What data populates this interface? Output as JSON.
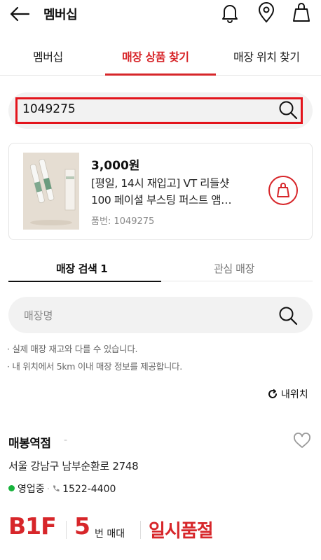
{
  "header": {
    "title": "멤버십"
  },
  "tabs": [
    {
      "label": "멤버십"
    },
    {
      "label": "매장 상품 찾기"
    },
    {
      "label": "매장 위치 찾기"
    }
  ],
  "search": {
    "value": "1049275"
  },
  "product": {
    "price": "3,000원",
    "name_line1": "[평일, 14시 재입고] VT 리들샷",
    "name_line2": "100 페이셜 부스팅 퍼스트 앰…",
    "code": "품번: 1049275"
  },
  "subtabs": [
    {
      "label": "매장 검색 1"
    },
    {
      "label": "관심 매장"
    }
  ],
  "store_search": {
    "placeholder": "매장명"
  },
  "notices": [
    "· 실제 매장 재고와 다를 수 있습니다.",
    "· 내 위치에서 5km 이내 매장 정보를 제공합니다."
  ],
  "my_location_label": "내위치",
  "store": {
    "name": "매봉역점",
    "dash": "-",
    "address": "서울 강남구 남부순환로 2748",
    "status": "영업중",
    "phone": "1522-4400",
    "floor": "B1F",
    "shelf_number": "5",
    "shelf_unit": "번 매대",
    "stock_status": "일시품절"
  },
  "colors": {
    "accent": "#d7262a",
    "open_status": "#17b33c"
  },
  "icons": [
    "back-arrow-icon",
    "bell-icon",
    "location-pin-icon",
    "shopping-bag-icon",
    "search-icon",
    "refresh-icon",
    "heart-icon",
    "phone-icon"
  ]
}
